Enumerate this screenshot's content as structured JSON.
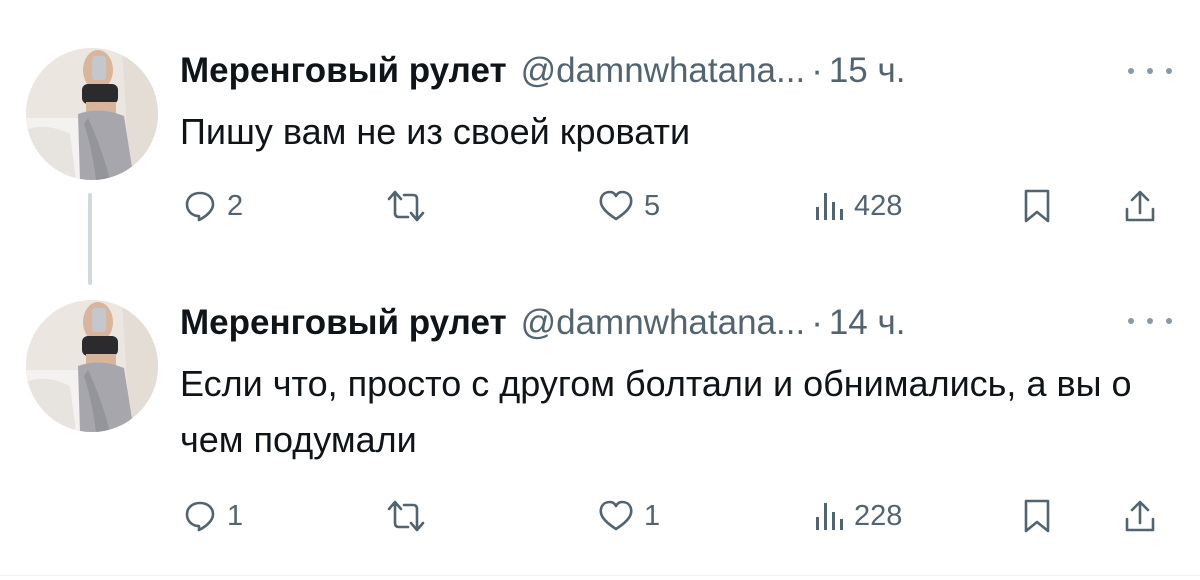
{
  "colors": {
    "text_primary": "#0f1419",
    "text_secondary": "#536471",
    "thread_line": "#cfd9de"
  },
  "tweets": [
    {
      "author": {
        "name": "Меренговый рулет",
        "handle": "@damnwhatana...",
        "avatar": "avatar-photo"
      },
      "separator": "·",
      "time": "15 ч.",
      "text": "Пишу вам не из своей кровати",
      "stats": {
        "replies": "2",
        "likes": "5",
        "views": "428"
      }
    },
    {
      "author": {
        "name": "Меренговый рулет",
        "handle": "@damnwhatana...",
        "avatar": "avatar-photo"
      },
      "separator": "·",
      "time": "14 ч.",
      "text": "Если что, просто с другом болтали и обнимались, а вы о чем подумали",
      "stats": {
        "replies": "1",
        "likes": "1",
        "views": "228"
      }
    }
  ],
  "icons": {
    "reply": "reply-icon",
    "retweet": "retweet-icon",
    "like": "heart-icon",
    "views": "views-icon",
    "bookmark": "bookmark-icon",
    "share": "share-icon",
    "more": "more-icon"
  }
}
